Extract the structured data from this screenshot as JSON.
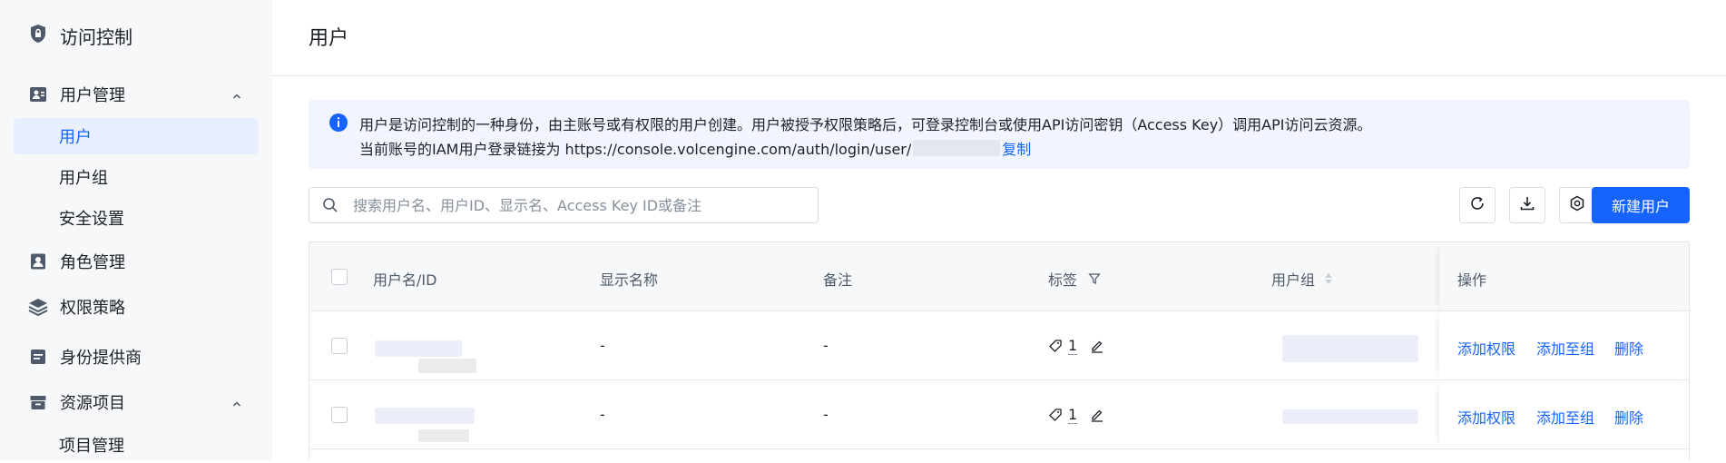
{
  "sidebar": {
    "title": "访问控制",
    "groups": [
      {
        "label": "用户管理",
        "expanded": true,
        "children": [
          "用户",
          "用户组",
          "安全设置"
        ]
      },
      {
        "label": "角色管理"
      },
      {
        "label": "权限策略"
      },
      {
        "label": "身份提供商"
      },
      {
        "label": "资源项目",
        "expanded": true,
        "children": [
          "项目管理"
        ]
      }
    ],
    "active": "用户"
  },
  "page": {
    "title": "用户"
  },
  "info": {
    "line1": "用户是访问控制的一种身份，由主账号或有权限的用户创建。用户被授予权限策略后，可登录控制台或使用API访问密钥（Access Key）调用API访问云资源。",
    "line2_prefix": "当前账号的IAM用户登录链接为 https://console.volcengine.com/auth/login/user/",
    "copy_label": "复制"
  },
  "search": {
    "placeholder": "搜索用户名、用户ID、显示名、Access Key ID或备注",
    "value": ""
  },
  "toolbar": {
    "create_label": "新建用户"
  },
  "table": {
    "columns": [
      "用户名/ID",
      "显示名称",
      "备注",
      "标签",
      "用户组",
      "操作"
    ],
    "rows": [
      {
        "display_name": "-",
        "remark": "-",
        "tag_count": "1",
        "actions": [
          "添加权限",
          "添加至组",
          "删除"
        ]
      },
      {
        "display_name": "-",
        "remark": "-",
        "tag_count": "1",
        "actions": [
          "添加权限",
          "添加至组",
          "删除"
        ]
      }
    ]
  },
  "colors": {
    "primary": "#1664ff",
    "active_bg": "#e8efff",
    "sidebar_bg": "#f7f8fa"
  }
}
